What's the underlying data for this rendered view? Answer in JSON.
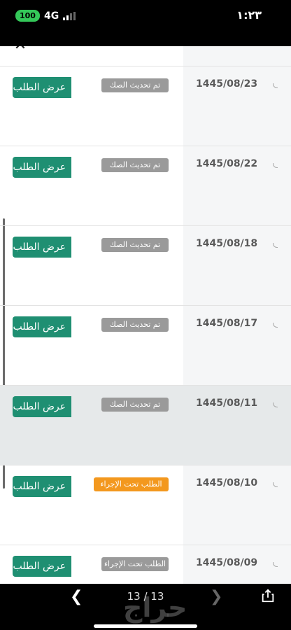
{
  "status_bar": {
    "battery": "100",
    "network": "4G",
    "time": "١:٢٣"
  },
  "colors": {
    "primary_button": "#1f8f72",
    "tag_gray": "#9a9a9a",
    "tag_orange": "#f3981e"
  },
  "close_icon": "close-icon",
  "rows": [
    {
      "date": "1445/08/23",
      "status": "تم تحديث الصك",
      "button": "عرض الطلب"
    },
    {
      "date": "1445/08/22",
      "status": "تم تحديث الصك",
      "button": "عرض الطلب"
    },
    {
      "date": "1445/08/18",
      "status": "تم تحديث الصك",
      "button": "عرض الطلب"
    },
    {
      "date": "1445/08/17",
      "status": "تم تحديث الصك",
      "button": "عرض الطلب"
    },
    {
      "date": "1445/08/11",
      "status": "تم تحديث الصك",
      "button": "عرض الطلب"
    },
    {
      "date": "1445/08/10",
      "status": "الطلب تحت الإجراء",
      "button": "عرض الطلب"
    },
    {
      "date": "1445/08/09",
      "status": "الطلب تحت الإجراء",
      "button": "عرض الطلب"
    }
  ],
  "viewer": {
    "page_counter": "13 / 13",
    "watermark": "حراج"
  }
}
